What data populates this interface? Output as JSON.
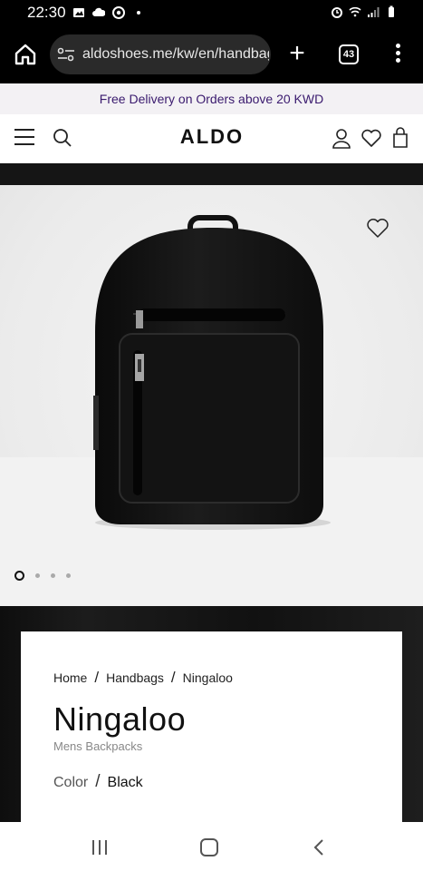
{
  "status_bar": {
    "time": "22:30",
    "left_icons": [
      "image-icon",
      "cloud-icon",
      "chrome-icon",
      "dot-icon"
    ],
    "right_icons": [
      "alarm-icon",
      "wifi-icon",
      "signal-icon",
      "battery-icon"
    ]
  },
  "browser": {
    "url": "aldoshoes.me/kw/en/handbag",
    "tab_count": "43"
  },
  "promo": {
    "text": "Free Delivery on Orders above 20 KWD"
  },
  "header": {
    "logo": "ALDO"
  },
  "gallery": {
    "slide_count": 4,
    "active_slide": 1
  },
  "product": {
    "breadcrumb": [
      "Home",
      "Handbags",
      "Ningaloo"
    ],
    "breadcrumb_separator": "/",
    "name": "Ningaloo",
    "category": "Mens Backpacks",
    "color_label": "Color",
    "color_value": "Black"
  },
  "colors": {
    "promo_text": "#3a1a6e",
    "promo_bg": "#f3f1f4",
    "product": "#111111"
  }
}
